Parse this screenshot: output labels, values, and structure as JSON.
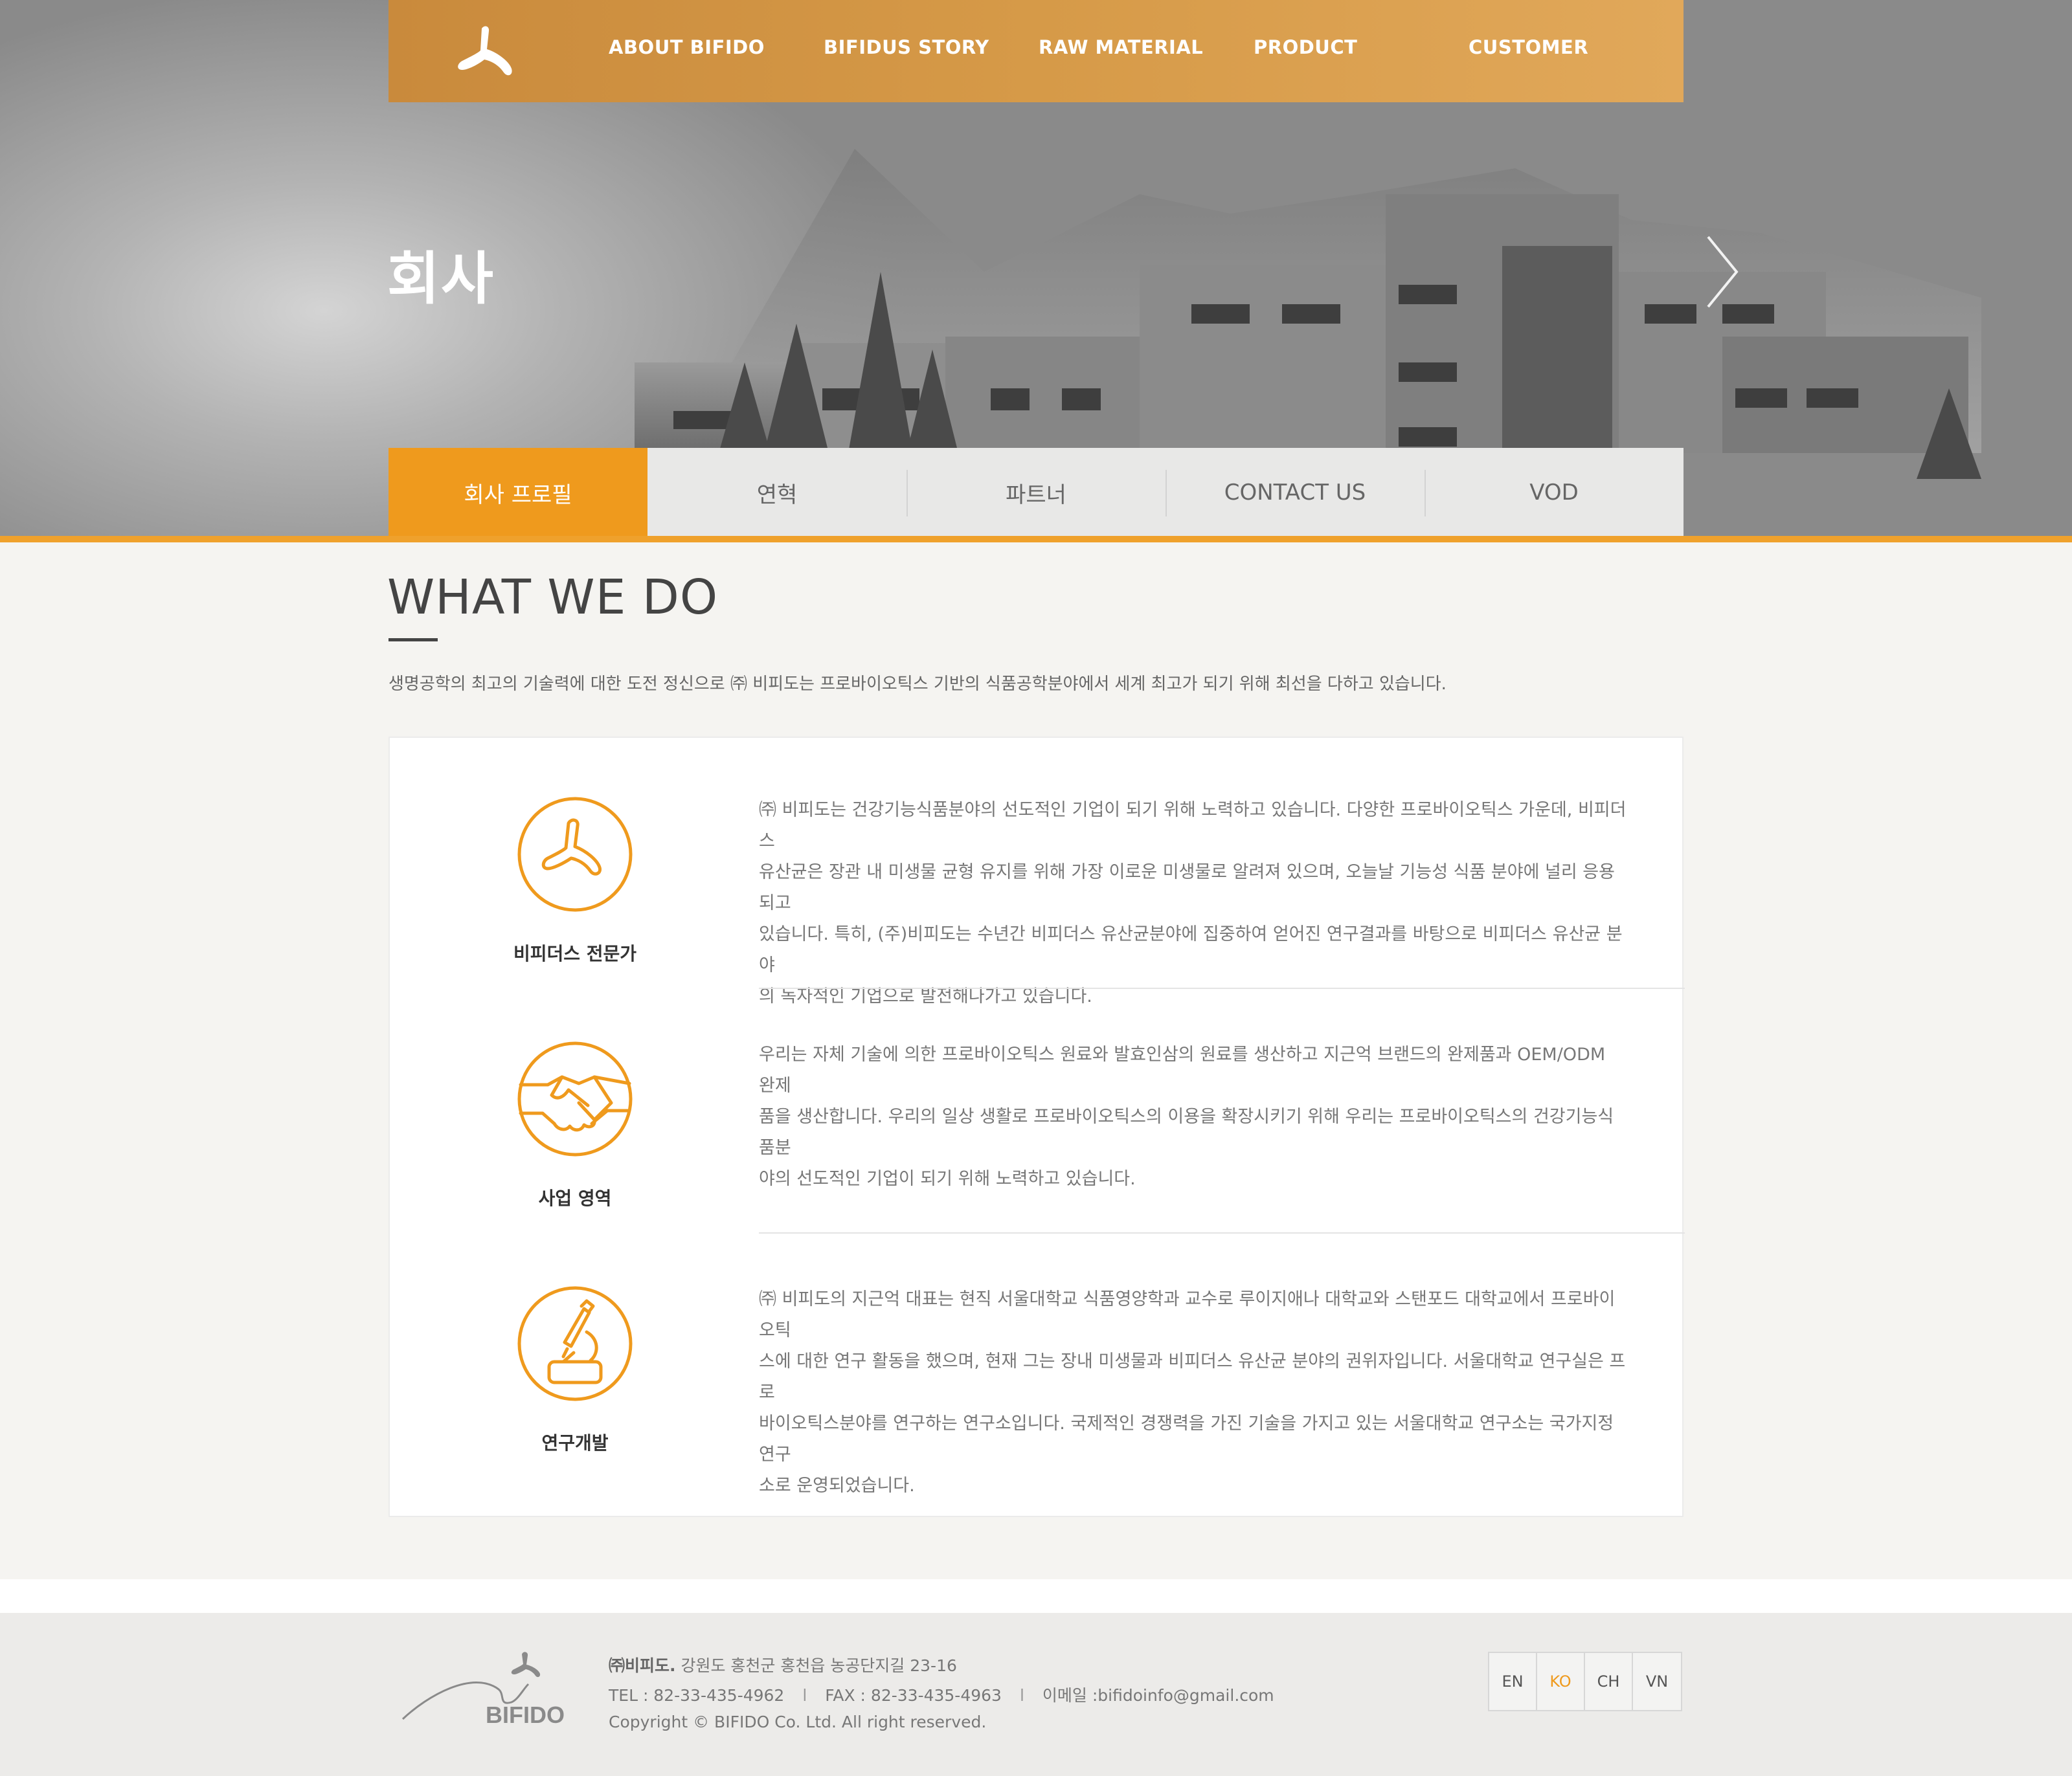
{
  "colors": {
    "accent": "#ef9a1d",
    "nav_bar": "#d69a48"
  },
  "header": {
    "logo_icon": "bifido-logo-icon",
    "nav": [
      {
        "label": "ABOUT BIFIDO"
      },
      {
        "label": "BIFIDUS STORY"
      },
      {
        "label": "RAW MATERIAL"
      },
      {
        "label": "PRODUCT"
      },
      {
        "label": "CUSTOMER"
      }
    ]
  },
  "hero": {
    "title": "회사",
    "next_icon": "chevron-right-icon"
  },
  "subtabs": [
    {
      "label": "회사 프로필",
      "active": true
    },
    {
      "label": "연혁"
    },
    {
      "label": "파트너"
    },
    {
      "label": "CONTACT US"
    },
    {
      "label": "VOD"
    }
  ],
  "main": {
    "title": "WHAT WE DO",
    "intro": "생명공학의 최고의 기술력에 대한 도전 정신으로 ㈜ 비피도는 프로바이오틱스 기반의 식품공학분야에서 세계 최고가 되기 위해 최선을 다하고 있습니다.",
    "items": [
      {
        "icon": "bifidus-icon",
        "label": "비피더스 전문가",
        "lines": [
          "㈜ 비피도는 건강기능식품분야의 선도적인 기업이 되기 위해 노력하고 있습니다. 다양한 프로바이오틱스 가운데, 비피더스",
          "유산균은 장관 내 미생물 균형 유지를 위해 가장 이로운 미생물로 알려져 있으며, 오늘날 기능성 식품 분야에 널리 응용되고",
          "있습니다. 특히, (주)비피도는 수년간 비피더스 유산균분야에 집중하여 얻어진 연구결과를 바탕으로 비피더스 유산균 분야",
          "의 독자적인 기업으로 발전해나가고 있습니다."
        ]
      },
      {
        "icon": "handshake-icon",
        "label": "사업 영역",
        "lines": [
          "우리는 자체 기술에 의한 프로바이오틱스 원료와 발효인삼의 원료를 생산하고 지근억 브랜드의 완제품과 OEM/ODM 완제",
          "품을 생산합니다. 우리의 일상 생활로 프로바이오틱스의 이용을 확장시키기 위해 우리는 프로바이오틱스의 건강기능식품분",
          "야의 선도적인 기업이 되기 위해 노력하고 있습니다."
        ]
      },
      {
        "icon": "microscope-icon",
        "label": "연구개발",
        "lines": [
          "㈜ 비피도의 지근억 대표는 현직 서울대학교 식품영양학과 교수로 루이지애나 대학교와 스탠포드 대학교에서 프로바이오틱",
          "스에 대한 연구 활동을 했으며, 현재 그는 장내 미생물과 비피더스 유산균 분야의 권위자입니다. 서울대학교 연구실은 프로",
          "바이오틱스분야를 연구하는 연구소입니다. 국제적인 경쟁력을 가진 기술을 가지고 있는 서울대학교 연구소는 국가지정연구",
          "소로 운영되었습니다."
        ]
      }
    ]
  },
  "footer": {
    "logo_text": "BIFIDO",
    "company": "㈜비피도.",
    "address": "강원도 홍천군 홍천읍 농공단지길 23-16",
    "tel": "TEL : 82-33-435-4962",
    "fax": "FAX : 82-33-435-4963",
    "email": "이메일 :bifidoinfo@gmail.com",
    "copyright": "Copyright © BIFIDO Co. Ltd. All right reserved.",
    "separator": "l",
    "languages": [
      {
        "label": "EN"
      },
      {
        "label": "KO",
        "active": true
      },
      {
        "label": "CH"
      },
      {
        "label": "VN"
      }
    ]
  }
}
